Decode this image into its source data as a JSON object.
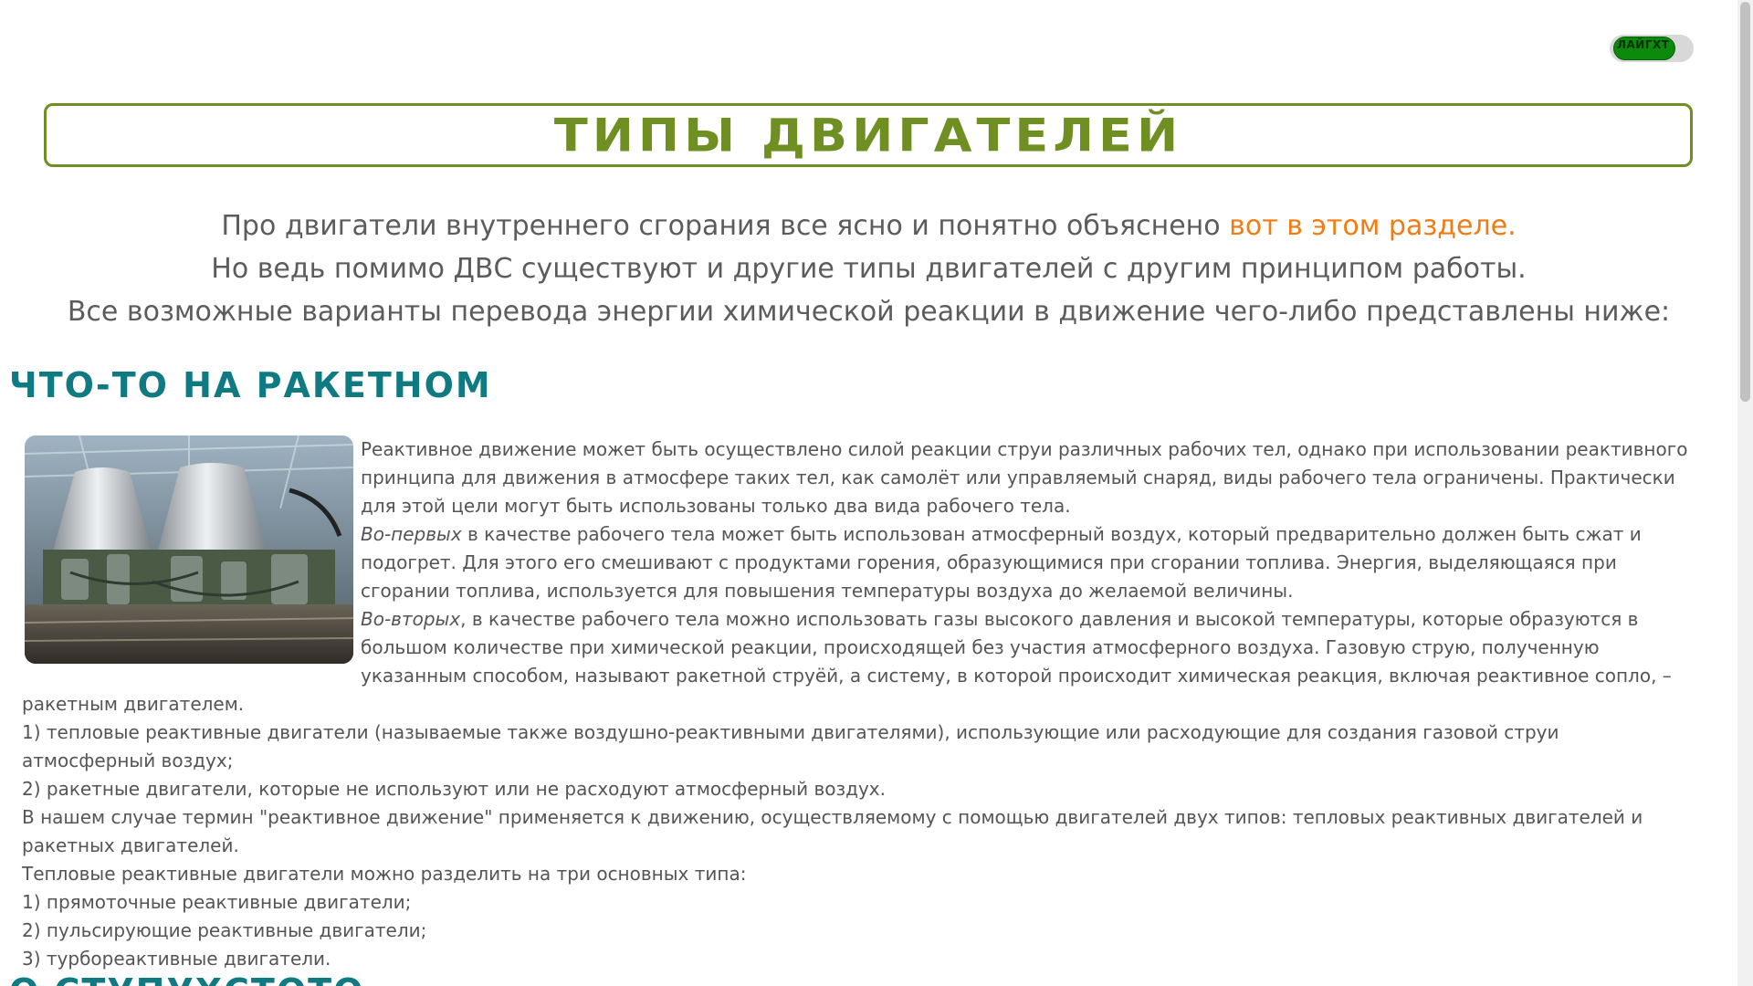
{
  "theme_toggle": {
    "label": "ЛАЙГХТ"
  },
  "title": "ТИПЫ ДВИГАТЕЛЕЙ",
  "intro": {
    "line1_text": "Про двигатели внутреннего сгорания все ясно и понятно объяснено ",
    "line1_link": "вот в этом разделе.",
    "line2": "Но ведь помимо ДВС существуют и другие типы двигателей с другим принципом работы.",
    "line3": "Все возможные варианты перевода энергии химической реакции в движение чего-либо представлены ниже:"
  },
  "section_rocket": {
    "heading": "ЧТО-ТО НА РАКЕТНОМ",
    "image_icon": "rocket-engine-photo",
    "p1": "Реактивное движение может быть осуществлено силой реакции струи различных рабочих тел, однако при использовании реактивного принципа для движения в атмосфере таких тел, как самолёт или управляемый снаряд, виды рабочего тела ограничены. Практически для этой цели могут быть использованы только два вида рабочего тела.",
    "p2_em": "Во-первых",
    "p2_text": " в качестве рабочего тела может быть использован атмосферный воздух, который предварительно должен быть сжат и подогрет. Для этого его смешивают с продуктами горения, образующимися при сгорании топлива. Энергия, выделяющаяся при сгорании топлива, используется для повышения температуры воздуха до желаемой величины.",
    "p3_em": "Во-вторых",
    "p3_text": ", в качестве рабочего тела можно использовать газы высокого давления и высокой температуры, которые образуются в большом количестве при химической реакции, происходящей без участия атмосферного воздуха. Газовую струю, полученную указанным способом, называют ракетной струёй, а систему, в которой происходит химическая реакция, включая реактивное сопло, – ракетным двигателем.",
    "p4": "1) тепловые реактивные двигатели (называемые также воздушно-реактивными двигателями), использующие или расходующие для создания газовой струи атмосферный воздух;",
    "p5": "2) ракетные двигатели, которые не используют или не расходуют атмосферный воздух.",
    "p6": "В нашем случае термин \"реактивное движение\" применяется к движению, осуществляемому с помощью двигателей двух типов: тепловых реактивных двигателей и ракетных двигателей.",
    "p7": "Тепловые реактивные двигатели можно разделить на три основных типа:",
    "p8": "1) прямоточные реактивные двигатели;",
    "p9": "2) пульсирующие реактивные двигатели;",
    "p10": "3) турбореактивные двигатели."
  },
  "next_heading": "О СТУПУХСТОТО"
}
